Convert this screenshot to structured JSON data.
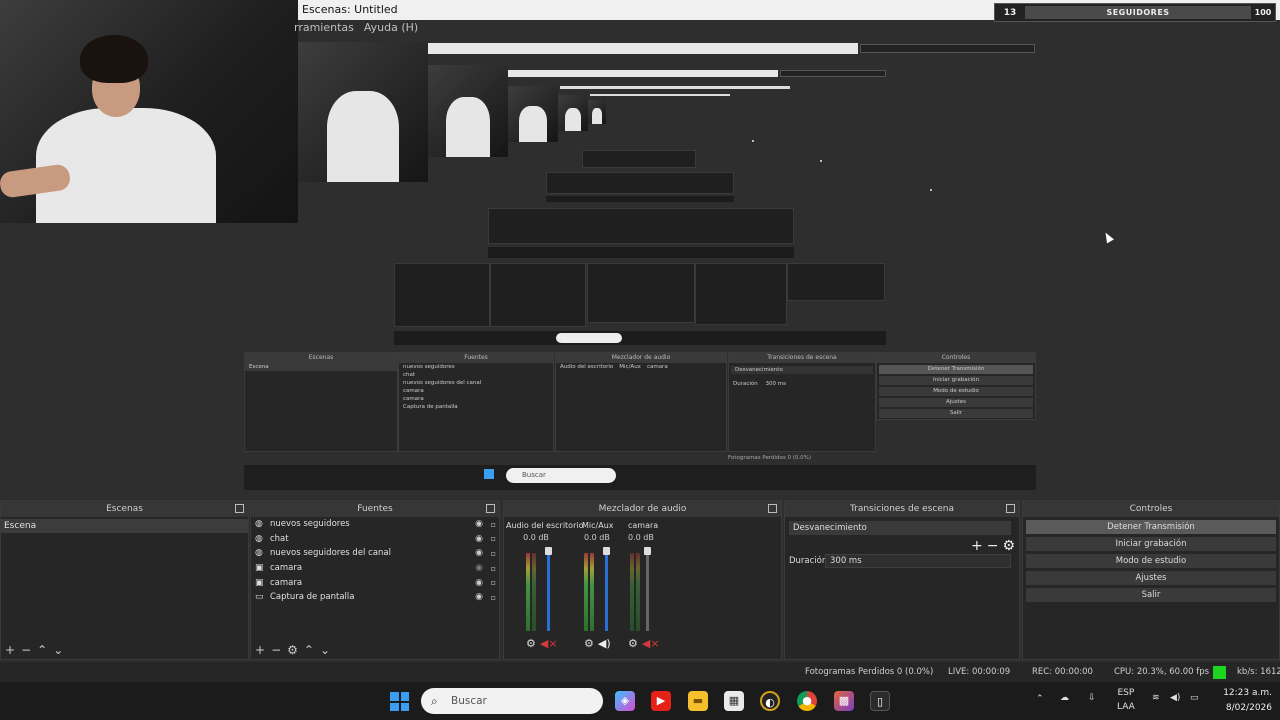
{
  "window": {
    "title": "Escenas: Untitled",
    "menu": [
      "rramientas",
      "Ayuda (H)"
    ]
  },
  "followers_widget": {
    "count": "13",
    "label": "SEGUIDORES",
    "right": "100"
  },
  "preview_copy": {
    "scenes_header": "Escenas",
    "sources_header": "Fuentes",
    "mixer_header": "Mezclador de audio",
    "transitions_header": "Transiciones de escena",
    "controls_header": "Controles",
    "scene_item": "Escena",
    "sources": [
      "nuevos seguidores",
      "chat",
      "nuevos seguidores del canal",
      "camara",
      "camara",
      "Captura de pantalla"
    ],
    "mixer_channels": [
      "Audio del escritorio",
      "Mic/Aux",
      "camara"
    ],
    "transition": "Desvanecimiento",
    "duration_label": "Duración",
    "duration_value": "300 ms",
    "controls": [
      "Detener Transmisión",
      "Iniciar grabación",
      "Modo de estudio",
      "Ajustes",
      "Salir"
    ],
    "status": "Fotogramas Perdidos 0 (0.0%)",
    "search_placeholder": "Buscar"
  },
  "docks": {
    "scenes": {
      "header": "Escenas",
      "items": [
        "Escena"
      ]
    },
    "sources": {
      "header": "Fuentes",
      "items": [
        {
          "name": "nuevos seguidores",
          "icon": "globe-icon"
        },
        {
          "name": "chat",
          "icon": "globe-icon"
        },
        {
          "name": "nuevos seguidores del canal",
          "icon": "globe-icon"
        },
        {
          "name": "camara",
          "icon": "camera-icon"
        },
        {
          "name": "camara",
          "icon": "camera-icon"
        },
        {
          "name": "Captura de pantalla",
          "icon": "monitor-icon"
        }
      ]
    },
    "mixer": {
      "header": "Mezclador de audio",
      "channels": [
        {
          "name": "Audio del escritorio",
          "db": "0.0 dB",
          "muted": true
        },
        {
          "name": "Mic/Aux",
          "db": "0.0 dB",
          "muted": false
        },
        {
          "name": "camara",
          "db": "0.0 dB",
          "muted": true
        }
      ]
    },
    "transitions": {
      "header": "Transiciones de escena",
      "selected": "Desvanecimiento",
      "duration_label": "Duración",
      "duration_value": "300 ms"
    },
    "controls": {
      "header": "Controles",
      "buttons": [
        "Detener Transmisión",
        "Iniciar grabación",
        "Modo de estudio",
        "Ajustes",
        "Salir"
      ]
    }
  },
  "statusbar": {
    "dropped": "Fotogramas Perdidos 0 (0.0%)",
    "live": "LIVE: 00:00:09",
    "rec": "REC: 00:00:00",
    "cpu": "CPU: 20.3%, 60.00 fps",
    "kbps": "kb/s: 1612",
    "live_color": "#1fd41f"
  },
  "taskbar": {
    "search_placeholder": "Buscar",
    "lang_top": "ESP",
    "lang_bottom": "LAA",
    "time": "12:23 a.m.",
    "date": "8/02/2026"
  }
}
